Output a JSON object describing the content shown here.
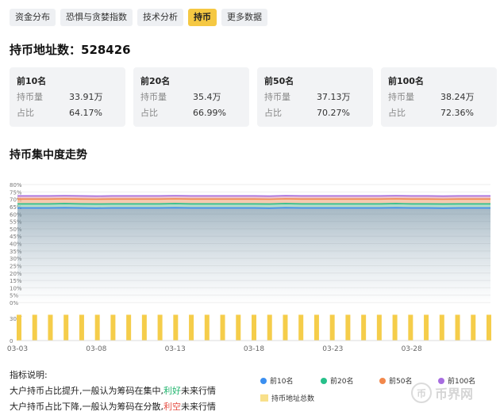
{
  "tabs": [
    {
      "label": "资金分布",
      "active": false
    },
    {
      "label": "恐惧与贪婪指数",
      "active": false
    },
    {
      "label": "技术分析",
      "active": false
    },
    {
      "label": "持币",
      "active": true
    },
    {
      "label": "更多数据",
      "active": false
    }
  ],
  "holders": {
    "title": "持币地址数：528426"
  },
  "cards": [
    {
      "head": "前10名",
      "k1": "持币量",
      "v1": "33.91万",
      "k2": "占比",
      "v2": "64.17%"
    },
    {
      "head": "前20名",
      "k1": "持币量",
      "v1": "35.4万",
      "k2": "占比",
      "v2": "66.99%"
    },
    {
      "head": "前50名",
      "k1": "持币量",
      "v1": "37.13万",
      "k2": "占比",
      "v2": "70.27%"
    },
    {
      "head": "前100名",
      "k1": "持币量",
      "v1": "38.24万",
      "k2": "占比",
      "v2": "72.36%"
    }
  ],
  "section_title": "持币集中度走势",
  "notes": {
    "heading": "指标说明:",
    "line1_pre": "大户持币占比提升,一般认为筹码在集中,",
    "line1_hl": "利好",
    "line1_post": "未来行情",
    "line2_pre": "大户持币占比下降,一般认为筹码在分散,",
    "line2_hl": "利空",
    "line2_post": "未来行情"
  },
  "legend": [
    {
      "label": "前10名",
      "color": "#3b8ff0",
      "shape": "dot"
    },
    {
      "label": "前20名",
      "color": "#27c08a",
      "shape": "dot"
    },
    {
      "label": "前50名",
      "color": "#f2884b",
      "shape": "dot"
    },
    {
      "label": "前100名",
      "color": "#a76de0",
      "shape": "dot"
    },
    {
      "label": "持币地址总数",
      "color": "#f8e08a",
      "shape": "square"
    }
  ],
  "watermark": {
    "glyph": "币",
    "text": "币界网"
  },
  "chart_data": {
    "type": "line",
    "x_tick_labels": [
      "03-03",
      "03-08",
      "03-13",
      "03-18",
      "03-23",
      "03-28"
    ],
    "y_tick_labels": [
      "80%",
      "75%",
      "70%",
      "65%",
      "60%",
      "55%",
      "50%",
      "45%",
      "40%",
      "35%",
      "30%",
      "25%",
      "20%",
      "15%",
      "10%",
      "5%",
      "0%"
    ],
    "bar_axis_labels": [
      "30万",
      "0"
    ],
    "ylim": [
      0,
      80
    ],
    "num_points": 31,
    "series": [
      {
        "name": "前100名",
        "color": "#a76de0",
        "value": 72.3
      },
      {
        "name": "前50名",
        "color": "#f2884b",
        "value": 70.2
      },
      {
        "name": "前20名",
        "color": "#27c08a",
        "value": 66.9
      },
      {
        "name": "前10名",
        "color": "#3b8ff0",
        "value": 64.1
      }
    ],
    "bars": {
      "name": "持币地址总数",
      "color": "#f5cd4a",
      "value_wan": 52.8,
      "ylim_wan": [
        0,
        60
      ]
    }
  }
}
